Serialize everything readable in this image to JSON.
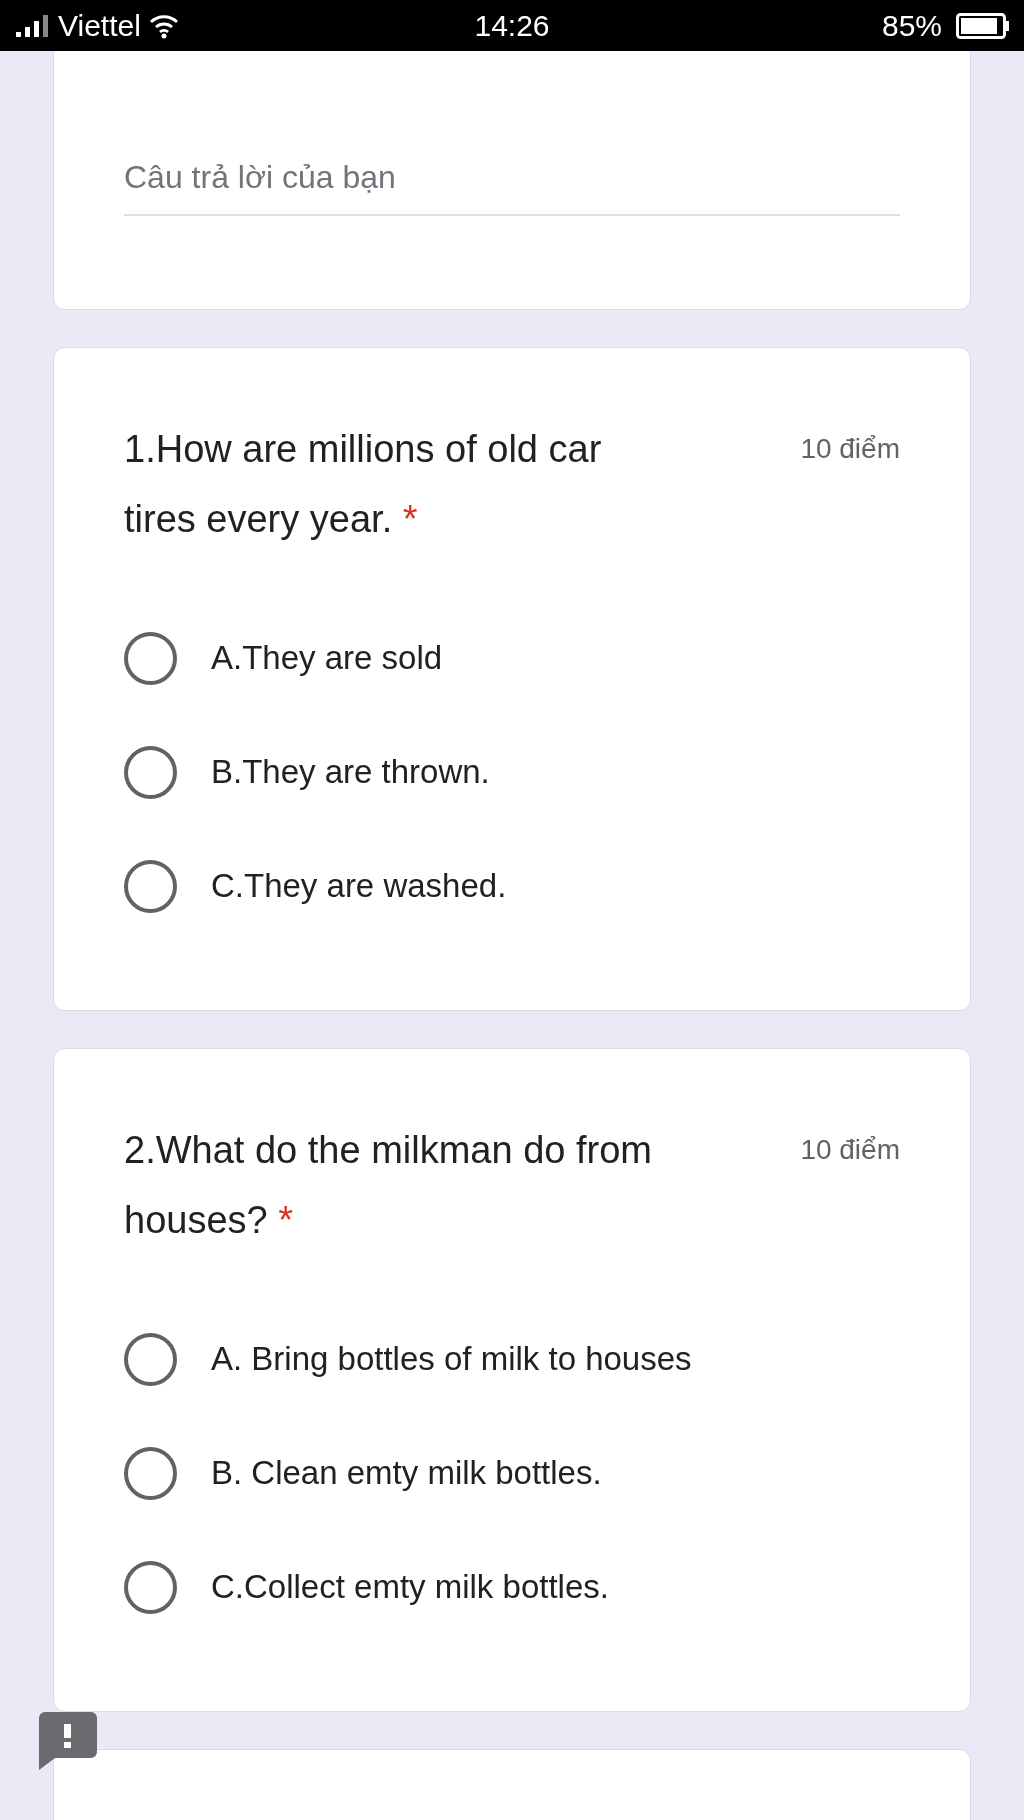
{
  "status_bar": {
    "carrier": "Viettel",
    "time": "14:26",
    "battery": "85%"
  },
  "answer_card": {
    "placeholder": "Câu trả lời của bạn"
  },
  "questions": [
    {
      "title": "1.How are millions of old car tires every year.",
      "required_mark": "*",
      "points": "10 điểm",
      "options": [
        {
          "label": "A.They are sold",
          "selected": false
        },
        {
          "label": "B.They are thrown.",
          "selected": false
        },
        {
          "label": "C.They are washed.",
          "selected": false
        }
      ]
    },
    {
      "title": "2.What do the milkman do from houses?",
      "required_mark": "*",
      "points": "10 điểm",
      "options": [
        {
          "label": "A. Bring bottles of milk to houses",
          "selected": false
        },
        {
          "label": "B. Clean emty milk bottles.",
          "selected": false
        },
        {
          "label": "C.Collect emty milk bottles.",
          "selected": false
        }
      ]
    }
  ]
}
